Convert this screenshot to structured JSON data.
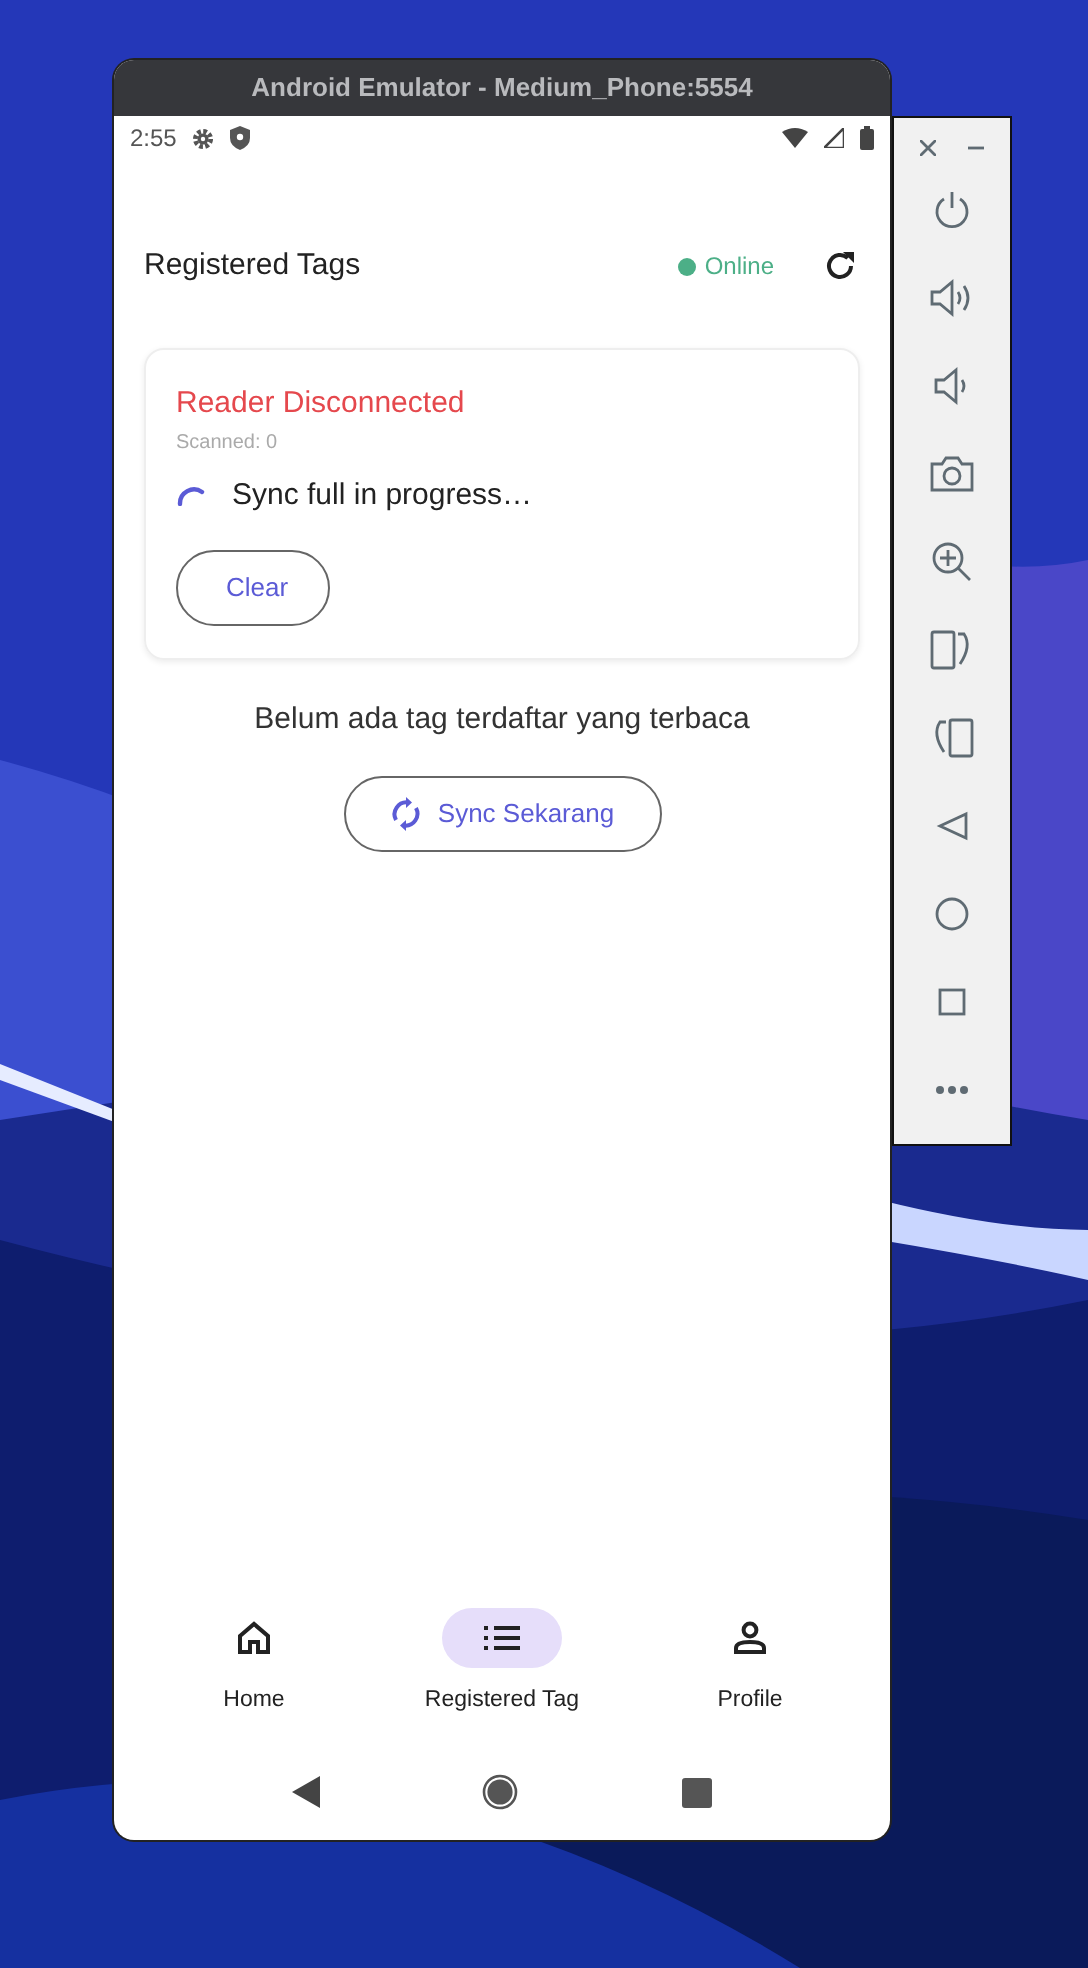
{
  "window": {
    "title": "Android Emulator - Medium_Phone:5554"
  },
  "status_bar": {
    "time": "2:55"
  },
  "app_bar": {
    "title": "Registered Tags",
    "online": true,
    "status": "Online"
  },
  "reader_card": {
    "status": "Reader Disconnected",
    "scanned": "Scanned: 0",
    "syncing": true,
    "sync_message": "Sync full in progress…",
    "clear_button": "Clear"
  },
  "empty_message": "Belum ada tag terdaftar yang terbaca",
  "sync_button": "Sync Sekarang",
  "bottom_nav": [
    {
      "kind": "home",
      "label": "Home",
      "selected": false
    },
    {
      "kind": "list",
      "label": "Registered Tag",
      "selected": true
    },
    {
      "kind": "profile",
      "label": "Profile",
      "selected": false
    }
  ]
}
